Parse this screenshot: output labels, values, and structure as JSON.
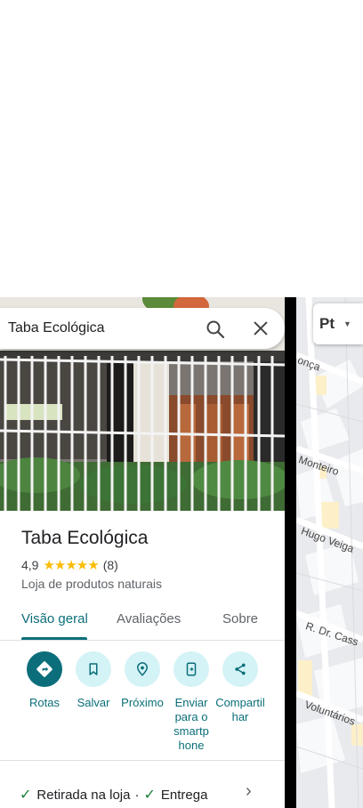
{
  "search": {
    "value": "Taba Ecológica"
  },
  "place": {
    "title": "Taba Ecológica",
    "rating": "4,9",
    "stars": "★★★★★",
    "reviews_count": "(8)",
    "category": "Loja de produtos naturais"
  },
  "tabs": [
    {
      "label": "Visão geral",
      "active": true
    },
    {
      "label": "Avaliações",
      "active": false
    },
    {
      "label": "Sobre",
      "active": false
    }
  ],
  "actions": [
    {
      "label": "Rotas",
      "icon": "directions-icon"
    },
    {
      "label": "Salvar",
      "icon": "bookmark-icon"
    },
    {
      "label": "Próximo",
      "icon": "nearby-icon"
    },
    {
      "label": "Enviar para o smartphone",
      "icon": "send-to-phone-icon"
    },
    {
      "label": "Compartilhar",
      "icon": "share-icon"
    }
  ],
  "services": {
    "pickup": "Retirada na loja",
    "separator": "·",
    "delivery": "Entrega"
  },
  "map": {
    "layer_label": "Pt",
    "streets": [
      "onça",
      "Monteiro",
      "Hugo Veiga",
      "R. Dr. Cass",
      "Voluntários"
    ]
  },
  "colors": {
    "accent": "#0b6e7a",
    "accent_light": "#d4f3f6",
    "star": "#fbbc04",
    "check": "#188038"
  }
}
